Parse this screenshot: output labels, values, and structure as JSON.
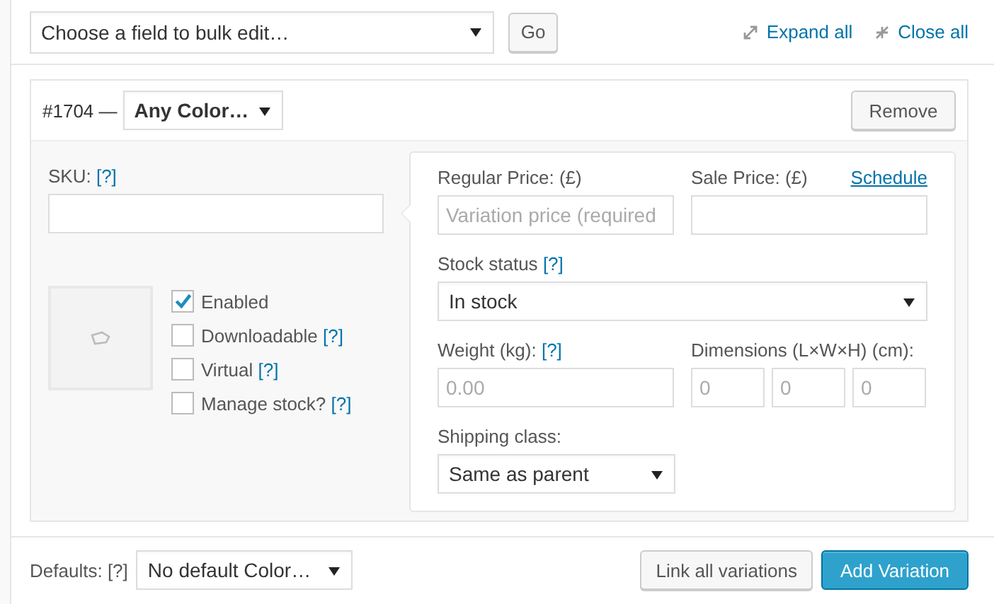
{
  "toolbar": {
    "bulk_select": "Choose a field to bulk edit…",
    "go_button": "Go",
    "expand_link": "Expand all",
    "close_link": "Close all"
  },
  "variation": {
    "number": "#1704 —",
    "attribute_select": "Any Color…",
    "remove_button": "Remove",
    "sku": {
      "label": "SKU:",
      "help": "[?]"
    },
    "options": [
      {
        "label": "Enabled",
        "checked": true
      },
      {
        "label": "Downloadable",
        "help": "[?]",
        "checked": false
      },
      {
        "label": "Virtual",
        "help": "[?]",
        "checked": false
      },
      {
        "label": "Manage stock?",
        "help": "[?]",
        "checked": false
      }
    ],
    "regular_price": {
      "label": "Regular Price: (£)",
      "placeholder": "Variation price (required"
    },
    "sale_price": {
      "label": "Sale Price: (£)",
      "link": "Schedule"
    },
    "stock_status": {
      "label": "Stock status",
      "help": "[?]",
      "value": "In stock"
    },
    "weight": {
      "label": "Weight (kg):",
      "help": "[?]",
      "placeholder": "0.00"
    },
    "dimensions": {
      "label": "Dimensions (L×W×H) (cm):",
      "placeholders": [
        "0",
        "0",
        "0"
      ]
    },
    "shipping_class": {
      "label": "Shipping class:",
      "value": "Same as parent"
    }
  },
  "footer": {
    "defaults_label": "Defaults:",
    "defaults_help": "[?]",
    "defaults_select": "No default Color…",
    "link_button": "Link all variations",
    "add_button": "Add Variation"
  }
}
